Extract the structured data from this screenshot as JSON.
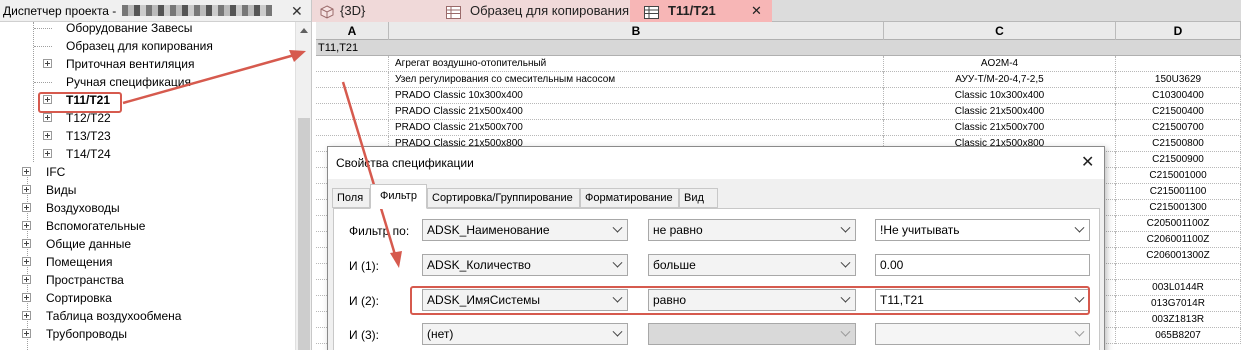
{
  "browser": {
    "title": "Диспетчер проекта -",
    "close_icon": "close-icon",
    "items": [
      {
        "label": "Оборудование Завесы",
        "expander": false,
        "bold": false
      },
      {
        "label": "Образец для копирования",
        "expander": false,
        "bold": false
      },
      {
        "label": "Приточная вентиляция",
        "expander": true,
        "bold": false
      },
      {
        "label": "Ручная спецификация",
        "expander": false,
        "bold": false
      },
      {
        "label": "T11/T21",
        "expander": true,
        "bold": true
      },
      {
        "label": "T12/T22",
        "expander": true,
        "bold": false
      },
      {
        "label": "T13/T23",
        "expander": true,
        "bold": false
      },
      {
        "label": "T14/T24",
        "expander": true,
        "bold": false
      },
      {
        "label": "IFC",
        "expander": true,
        "bold": false
      },
      {
        "label": "Виды",
        "expander": true,
        "bold": false
      },
      {
        "label": "Воздуховоды",
        "expander": true,
        "bold": false
      },
      {
        "label": "Вспомогательные",
        "expander": true,
        "bold": false
      },
      {
        "label": "Общие данные",
        "expander": true,
        "bold": false
      },
      {
        "label": "Помещения",
        "expander": true,
        "bold": false
      },
      {
        "label": "Пространства",
        "expander": true,
        "bold": false
      },
      {
        "label": "Сортировка",
        "expander": true,
        "bold": false
      },
      {
        "label": "Таблица воздухообмена",
        "expander": true,
        "bold": false
      },
      {
        "label": "Трубопроводы",
        "expander": true,
        "bold": false
      }
    ]
  },
  "tabs": [
    {
      "label": "{3D}",
      "icon": "3d-view-icon",
      "active": false
    },
    {
      "label": "Образец для копирования",
      "icon": "schedule-icon",
      "active": false
    },
    {
      "label": "T11/T21",
      "icon": "schedule-icon",
      "active": true,
      "close": "✕"
    }
  ],
  "schedule": {
    "columns": [
      "A",
      "B",
      "C",
      "D"
    ],
    "group_header": "T11,T21",
    "rows": [
      {
        "b": "Агрегат воздушно-отопительный",
        "c": "AO2M-4",
        "d": ""
      },
      {
        "b": "Узел регулирования со смесительным насосом",
        "c": "АУУ-Т/М-20-4,7-2,5",
        "d": "150U3629"
      },
      {
        "b": "PRADO Classic 10x300x400",
        "c": "Classic 10x300x400",
        "d": "C10300400"
      },
      {
        "b": "PRADO Classic 21x500x400",
        "c": "Classic 21x500x400",
        "d": "C21500400"
      },
      {
        "b": "PRADO Classic 21x500x700",
        "c": "Classic 21x500x700",
        "d": "C21500700"
      },
      {
        "b": "PRADO Classic 21x500x800",
        "c": "Classic 21x500x800",
        "d": "C21500800"
      },
      {
        "b": "",
        "c": "",
        "d": "C21500900"
      },
      {
        "b": "",
        "c": "",
        "d": "C215001000"
      },
      {
        "b": "",
        "c": "",
        "d": "C215001100"
      },
      {
        "b": "",
        "c": "",
        "d": "C215001300"
      },
      {
        "b": "",
        "c": "",
        "d": "C205001100Z"
      },
      {
        "b": "",
        "c": "",
        "d": "C206001100Z"
      },
      {
        "b": "",
        "c": "",
        "d": "C206001300Z"
      },
      {
        "b": "",
        "c": "",
        "d": ""
      },
      {
        "b": "",
        "c": "",
        "d": "003L0144R"
      },
      {
        "b": "",
        "c": "",
        "d": "013G7014R"
      },
      {
        "b": "",
        "c": "",
        "d": "003Z1813R"
      },
      {
        "b": "",
        "c": "",
        "d": "065B8207"
      }
    ]
  },
  "dialog": {
    "title": "Свойства спецификации",
    "close": "✕",
    "tabs": [
      "Поля",
      "Фильтр",
      "Сортировка/Группирование",
      "Форматирование",
      "Вид"
    ],
    "active_tab": "Фильтр",
    "filters": [
      {
        "label": "Фильтр по:",
        "field": "ADSK_Наименование",
        "condition": "не равно",
        "value": "!Не учитывать",
        "value_type": "dropdown",
        "enabled": true
      },
      {
        "label": "И (1):",
        "field": "ADSK_Количество",
        "condition": "больше",
        "value": "0.00",
        "value_type": "text",
        "enabled": true
      },
      {
        "label": "И (2):",
        "field": "ADSK_ИмяСистемы",
        "condition": "равно",
        "value": "T11,T21",
        "value_type": "dropdown",
        "enabled": true
      },
      {
        "label": "И (3):",
        "field": "(нет)",
        "condition": "",
        "value": "",
        "value_type": "dropdown",
        "enabled": false
      }
    ]
  },
  "annotations": {
    "color": "#d65a4e"
  },
  "colors": {
    "active_tab_bg": "#f7b6b6",
    "inactive_tab_bg": "#f0d9d9",
    "group_row_bg": "#d7d7d7"
  }
}
